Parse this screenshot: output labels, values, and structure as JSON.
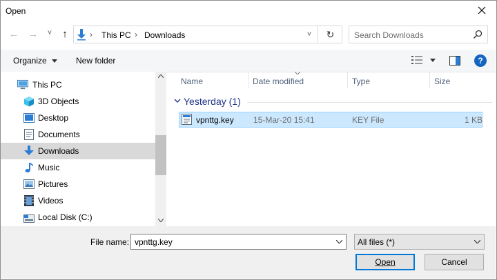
{
  "window": {
    "title": "Open"
  },
  "nav": {
    "back": "←",
    "forward": "→",
    "recent": "˅",
    "up": "↑",
    "refresh": "↻"
  },
  "address": {
    "crumbs": [
      "This PC",
      "Downloads"
    ],
    "sep": "›",
    "dropdown": "˅"
  },
  "search": {
    "placeholder": "Search Downloads"
  },
  "toolbar": {
    "organize": "Organize",
    "new_folder": "New folder",
    "help": "?"
  },
  "sidebar": {
    "items": [
      {
        "label": "This PC"
      },
      {
        "label": "3D Objects"
      },
      {
        "label": "Desktop"
      },
      {
        "label": "Documents"
      },
      {
        "label": "Downloads"
      },
      {
        "label": "Music"
      },
      {
        "label": "Pictures"
      },
      {
        "label": "Videos"
      },
      {
        "label": "Local Disk (C:)"
      }
    ]
  },
  "columns": {
    "name": "Name",
    "date": "Date modified",
    "type": "Type",
    "size": "Size"
  },
  "group": {
    "label": "Yesterday (1)"
  },
  "files": [
    {
      "name": "vpnttg.key",
      "date": "15-Mar-20 15:41",
      "type": "KEY File",
      "size": "1 KB"
    }
  ],
  "footer": {
    "filename_label": "File name:",
    "filename_value": "vpnttg.key",
    "filetype_value": "All files (*)",
    "open_label": "Open",
    "cancel_label": "Cancel"
  },
  "colors": {
    "accent": "#0078d7",
    "selection": "#cce8ff",
    "folder_blue": "#1e3287"
  }
}
